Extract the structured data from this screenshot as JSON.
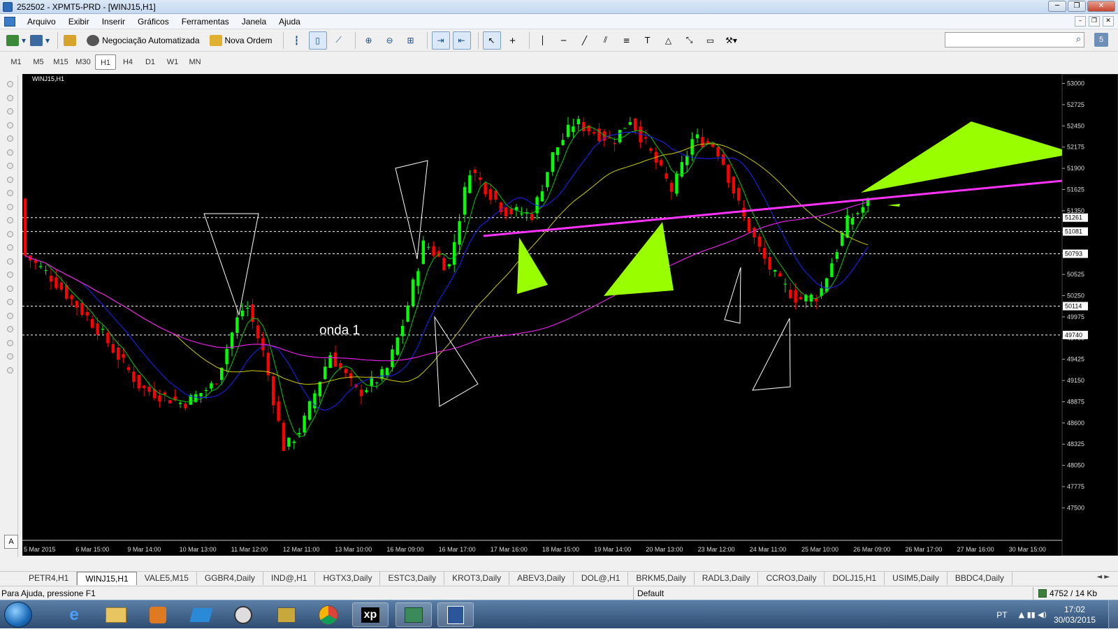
{
  "window": {
    "title": "252502 - XPMT5-PRD - [WINJ15,H1]",
    "controls": {
      "minimize": "─",
      "restore": "❐",
      "close": "✕"
    }
  },
  "menu": [
    "Arquivo",
    "Exibir",
    "Inserir",
    "Gráficos",
    "Ferramentas",
    "Janela",
    "Ajuda"
  ],
  "mdi_controls": {
    "minimize": "–",
    "restore": "❐",
    "close": "✕"
  },
  "toolbar": {
    "algo_trading": "Negociação Automatizada",
    "new_order": "Nova Ordem",
    "search_icon": "⌕",
    "help_label": "5"
  },
  "timeframes": [
    "M1",
    "M5",
    "M15",
    "M30",
    "H1",
    "H4",
    "D1",
    "W1",
    "MN"
  ],
  "active_timeframe": "H1",
  "chart": {
    "symbol_label": "WINJ15,H1",
    "annotation": "onda 1",
    "corner_label": "A",
    "price_axis": [
      "53000",
      "52725",
      "52450",
      "52175",
      "51900",
      "51625",
      "51350",
      "51075",
      "50800",
      "50525",
      "50250",
      "49975",
      "49700",
      "49425",
      "49150",
      "48875",
      "48600",
      "48325",
      "48050",
      "47775",
      "47500"
    ],
    "price_range": [
      47350,
      53050
    ],
    "price_tags": [
      "51261",
      "51081",
      "50793",
      "50114",
      "49740"
    ],
    "time_axis": [
      "5 Mar 2015",
      "6 Mar 15:00",
      "9 Mar 14:00",
      "10 Mar 13:00",
      "11 Mar 12:00",
      "12 Mar 11:00",
      "13 Mar 10:00",
      "16 Mar 09:00",
      "16 Mar 17:00",
      "17 Mar 16:00",
      "18 Mar 15:00",
      "19 Mar 14:00",
      "20 Mar 13:00",
      "23 Mar 12:00",
      "24 Mar 11:00",
      "25 Mar 10:00",
      "26 Mar 09:00",
      "26 Mar 17:00",
      "27 Mar 16:00",
      "30 Mar 15:00"
    ],
    "colors": {
      "bull": "#00ff00",
      "bear": "#ff0000",
      "ma_fast": "#00cc00",
      "ma_mid": "#2020ff",
      "ma_slow": "#cccc00",
      "ma_long": "#e020e0",
      "trendline": "#ff33ff",
      "fill": "#99ff00",
      "tag_bg": "#ffffff"
    }
  },
  "tabs": [
    "PETR4,H1",
    "WINJ15,H1",
    "VALE5,M15",
    "GGBR4,Daily",
    "IND@,H1",
    "HGTX3,Daily",
    "ESTC3,Daily",
    "KROT3,Daily",
    "ABEV3,Daily",
    "DOL@,H1",
    "BRKM5,Daily",
    "RADL3,Daily",
    "CCRO3,Daily",
    "DOLJ15,H1",
    "USIM5,Daily",
    "BBDC4,Daily"
  ],
  "active_tab": "WINJ15,H1",
  "tab_arrows": "◄ ►",
  "status": {
    "help": "Para Ajuda, pressione F1",
    "profile": "Default",
    "traffic": "4752 / 14 Kb"
  },
  "taskbar": {
    "xp_label": "xp",
    "lang": "PT",
    "tray_symbols": "▲ ▮▮ ◀)",
    "time": "17:02",
    "date": "30/03/2015"
  }
}
